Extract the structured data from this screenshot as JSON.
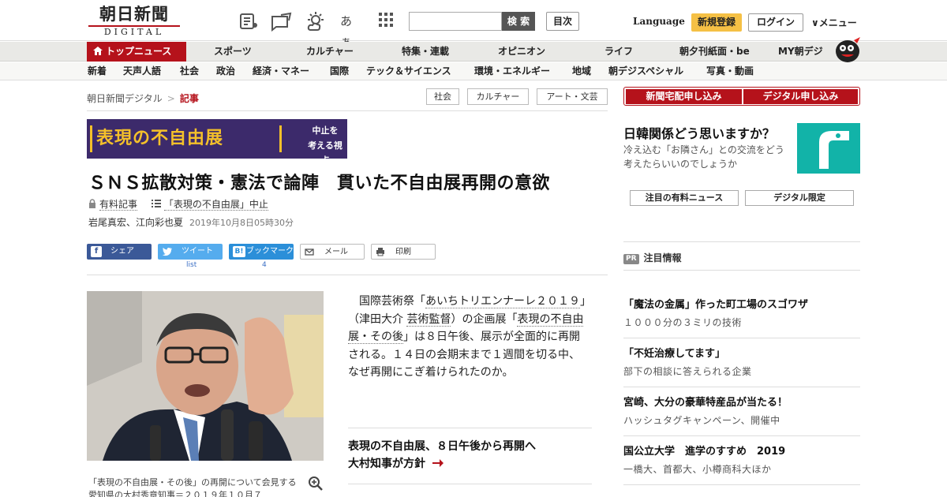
{
  "header": {
    "logo_jp": "朝日新聞",
    "logo_en": "DIGITAL",
    "search_button": "検 索",
    "toc_button": "目次",
    "language": "Language",
    "signup": "新規登録",
    "login": "ログイン",
    "menu": "∨メニュー",
    "font_size_icon_label": "あぁ"
  },
  "nav_primary": [
    "トップニュース",
    "スポーツ",
    "カルチャー",
    "特集・連載",
    "オピニオン",
    "ライフ",
    "朝夕刊紙面・be",
    "MY朝デジ"
  ],
  "nav_secondary": [
    "新着",
    "天声人語",
    "社会",
    "政治",
    "経済・マネー",
    "国際",
    "テック＆サイエンス",
    "環境・エネルギー",
    "地域",
    "朝デジスペシャル",
    "写真・動画"
  ],
  "breadcrumb": {
    "home": "朝日新聞デジタル",
    "sep": ">",
    "current": "記事"
  },
  "tags": [
    "社会",
    "カルチャー",
    "アート・文芸"
  ],
  "banner": {
    "title": "表現の不自由展",
    "sub_1": "中止を",
    "sub_2": "考える視点"
  },
  "article": {
    "headline": "ＳＮＳ拡散対策・憲法で論陣　貫いた不自由展再開の意欲",
    "paid_label": "有料記事",
    "series_label": "「表現の不自由展」中止",
    "authors": "岩尾真宏、江向彩也夏",
    "datetime": "2019年10月8日05時30分",
    "body_1": "国際芸術祭「",
    "body_link_1": "あいちトリエンナーレ２０１９",
    "body_2": "」（津田大介 ",
    "body_link_2": "芸術監督",
    "body_3": "）の企画展「",
    "body_link_3": "表現の不自由展・その後",
    "body_4": "」は８日午後、展示が全面的に再開される。１４日の会期末まで１週間を切る中、なぜ再開にこぎ着けられたのか。",
    "caption": "「表現の不自由展・その後」の再開について会見する愛知県の大村秀章知事＝２０１９年１０月７",
    "related_title_1": "表現の不自由展、８日午後から再開へ",
    "related_title_2": "大村知事が方針"
  },
  "share": {
    "facebook": "シェア",
    "twitter": "ツイート",
    "hatena": "ブックマーク",
    "mail": "メール",
    "print": "印刷",
    "twitter_count": "list",
    "hatena_count": "4"
  },
  "sidebar": {
    "btn_delivery": "新聞宅配申し込み",
    "btn_digital": "デジタル申し込み",
    "promo_title": "日韓関係どう思いますか？",
    "promo_sub": "冷え込む「お隣さん」との交流をどう考えたらいいのでしょうか",
    "btn_paid_news": "注目の有料ニュース",
    "btn_digital_only": "デジタル限定",
    "pr_badge": "PR",
    "pr_heading": "注目情報",
    "pr_items": [
      {
        "title": "「魔法の金属」作った町工場のスゴワザ",
        "sub": "１０００分の３ミリの技術"
      },
      {
        "title": "「不妊治療してます」",
        "sub": "部下の相談に答えられる企業"
      },
      {
        "title": "宮崎、大分の豪華特産品が当たる！",
        "sub": "ハッシュタグキャンペーン、開催中"
      },
      {
        "title": "国公立大学　進学のすすめ　2019",
        "sub": "一橋大、首都大、小樽商科大ほか"
      }
    ]
  },
  "colors": {
    "brand_red": "#b5121b",
    "signup_yellow": "#f5c045",
    "promo_teal": "#12b3a8",
    "banner_purple": "#3c2a6b",
    "banner_gold": "#f4c02a"
  }
}
